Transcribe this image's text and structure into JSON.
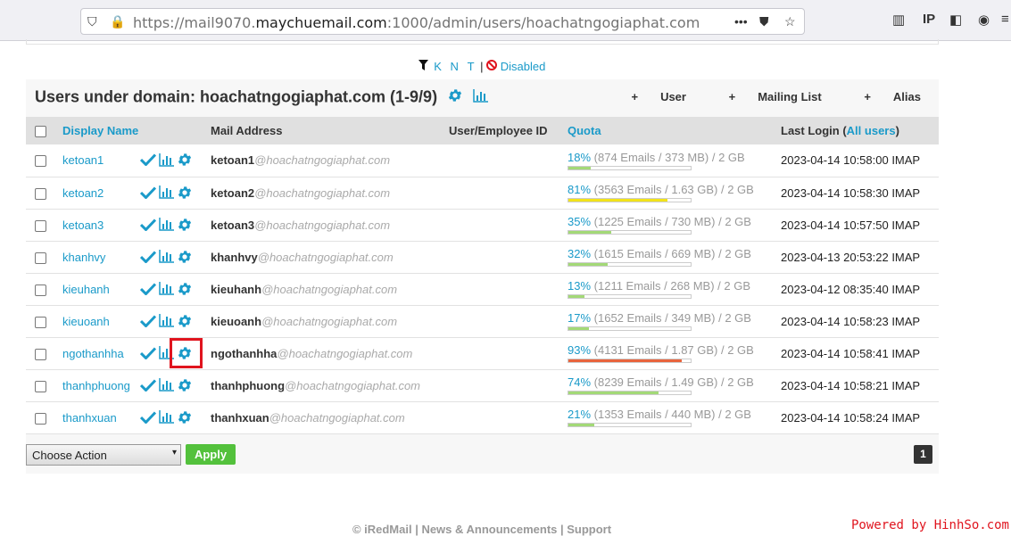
{
  "browser": {
    "url_prefix": "https://mail9070.",
    "url_host": "maychuemail.com",
    "url_suffix": ":1000/admin/users/hoachatngogiaphat.com"
  },
  "filter": {
    "k": "K",
    "n": "N",
    "t": "T",
    "sep": "|",
    "disabled": "Disabled"
  },
  "header": {
    "title": "Users under domain: hoachatngogiaphat.com (1-9/9)",
    "add_user": "User",
    "add_mailing_list": "Mailing List",
    "add_alias": "Alias"
  },
  "table": {
    "col_display_name": "Display Name",
    "col_mail_address": "Mail Address",
    "col_employee_id": "User/Employee ID",
    "col_quota": "Quota",
    "col_last_login": "Last Login (",
    "col_last_login_link": "All users",
    "col_last_login_end": ")",
    "domain": "@hoachatngogiaphat.com",
    "rows": [
      {
        "name": "ketoan1",
        "user": "ketoan1",
        "pct": "18%",
        "info": "(874 Emails / 373 MB) / 2 GB",
        "level": 0.18,
        "color": "#a3d977",
        "login": "2023-04-14 10:58:00 IMAP"
      },
      {
        "name": "ketoan2",
        "user": "ketoan2",
        "pct": "81%",
        "info": "(3563 Emails / 1.63 GB) / 2 GB",
        "level": 0.81,
        "color": "#f2e31a",
        "login": "2023-04-14 10:58:30 IMAP"
      },
      {
        "name": "ketoan3",
        "user": "ketoan3",
        "pct": "35%",
        "info": "(1225 Emails / 730 MB) / 2 GB",
        "level": 0.35,
        "color": "#a3d977",
        "login": "2023-04-14 10:57:50 IMAP"
      },
      {
        "name": "khanhvy",
        "user": "khanhvy",
        "pct": "32%",
        "info": "(1615 Emails / 669 MB) / 2 GB",
        "level": 0.32,
        "color": "#a3d977",
        "login": "2023-04-13 20:53:22 IMAP"
      },
      {
        "name": "kieuhanh",
        "user": "kieuhanh",
        "pct": "13%",
        "info": "(1211 Emails / 268 MB) / 2 GB",
        "level": 0.13,
        "color": "#a3d977",
        "login": "2023-04-12 08:35:40 IMAP"
      },
      {
        "name": "kieuoanh",
        "user": "kieuoanh",
        "pct": "17%",
        "info": "(1652 Emails / 349 MB) / 2 GB",
        "level": 0.17,
        "color": "#a3d977",
        "login": "2023-04-14 10:58:23 IMAP"
      },
      {
        "name": "ngothanhha",
        "user": "ngothanhha",
        "pct": "93%",
        "info": "(4131 Emails / 1.87 GB) / 2 GB",
        "level": 0.93,
        "color": "#e9643d",
        "login": "2023-04-14 10:58:41 IMAP"
      },
      {
        "name": "thanhphuong",
        "user": "thanhphuong",
        "pct": "74%",
        "info": "(8239 Emails / 1.49 GB) / 2 GB",
        "level": 0.74,
        "color": "#a3d977",
        "login": "2023-04-14 10:58:21 IMAP"
      },
      {
        "name": "thanhxuan",
        "user": "thanhxuan",
        "pct": "21%",
        "info": "(1353 Emails / 440 MB) / 2 GB",
        "level": 0.21,
        "color": "#a3d977",
        "login": "2023-04-14 10:58:24 IMAP"
      }
    ]
  },
  "footer": {
    "action_select": "Choose Action",
    "apply": "Apply",
    "page": "1",
    "links": "© iRedMail | News & Announcements | Support",
    "powered": "Powered by HinhSo.com"
  },
  "colors": {
    "accent": "#1a9ac9",
    "apply_green": "#53c13c",
    "highlight_red": "#e0141e"
  }
}
